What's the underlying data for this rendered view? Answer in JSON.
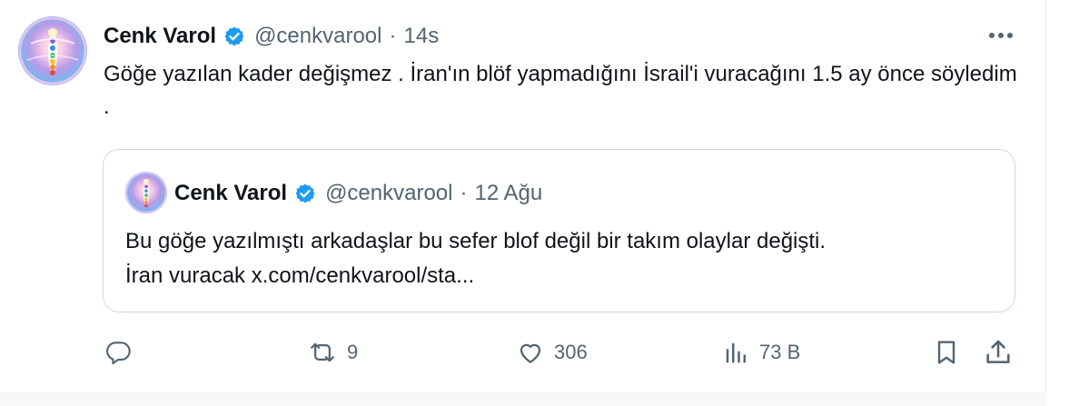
{
  "tweet": {
    "author_name": "Cenk Varol",
    "handle": "@cenkvarool",
    "separator": "·",
    "time": "14s",
    "text": "Göğe yazılan kader değişmez . İran'ın blöf yapmadığını İsrail'i vuracağını 1.5 ay önce söyledim .",
    "verified": true
  },
  "quoted_tweet": {
    "author_name": "Cenk Varol",
    "handle": "@cenkvarool",
    "separator": "·",
    "time": "12 Ağu",
    "text_line1": "Bu göğe yazılmıştı arkadaşlar bu sefer blof değil bir takım olaylar değişti.",
    "text_line2": "İran vuracak x.com/cenkvarool/sta...",
    "verified": true
  },
  "actions": {
    "reply_count": "",
    "retweet_count": "9",
    "like_count": "306",
    "views_count": "73 B"
  },
  "icons": {
    "reply": "reply-icon",
    "retweet": "retweet-icon",
    "like": "heart-icon",
    "views": "views-chart-icon",
    "bookmark": "bookmark-icon",
    "share": "share-icon",
    "more": "more-icon",
    "verified": "verified-badge-icon"
  },
  "colors": {
    "text": "#0f1419",
    "secondary": "#536471",
    "verified": "#1d9bf0",
    "border": "#cfd9de"
  }
}
